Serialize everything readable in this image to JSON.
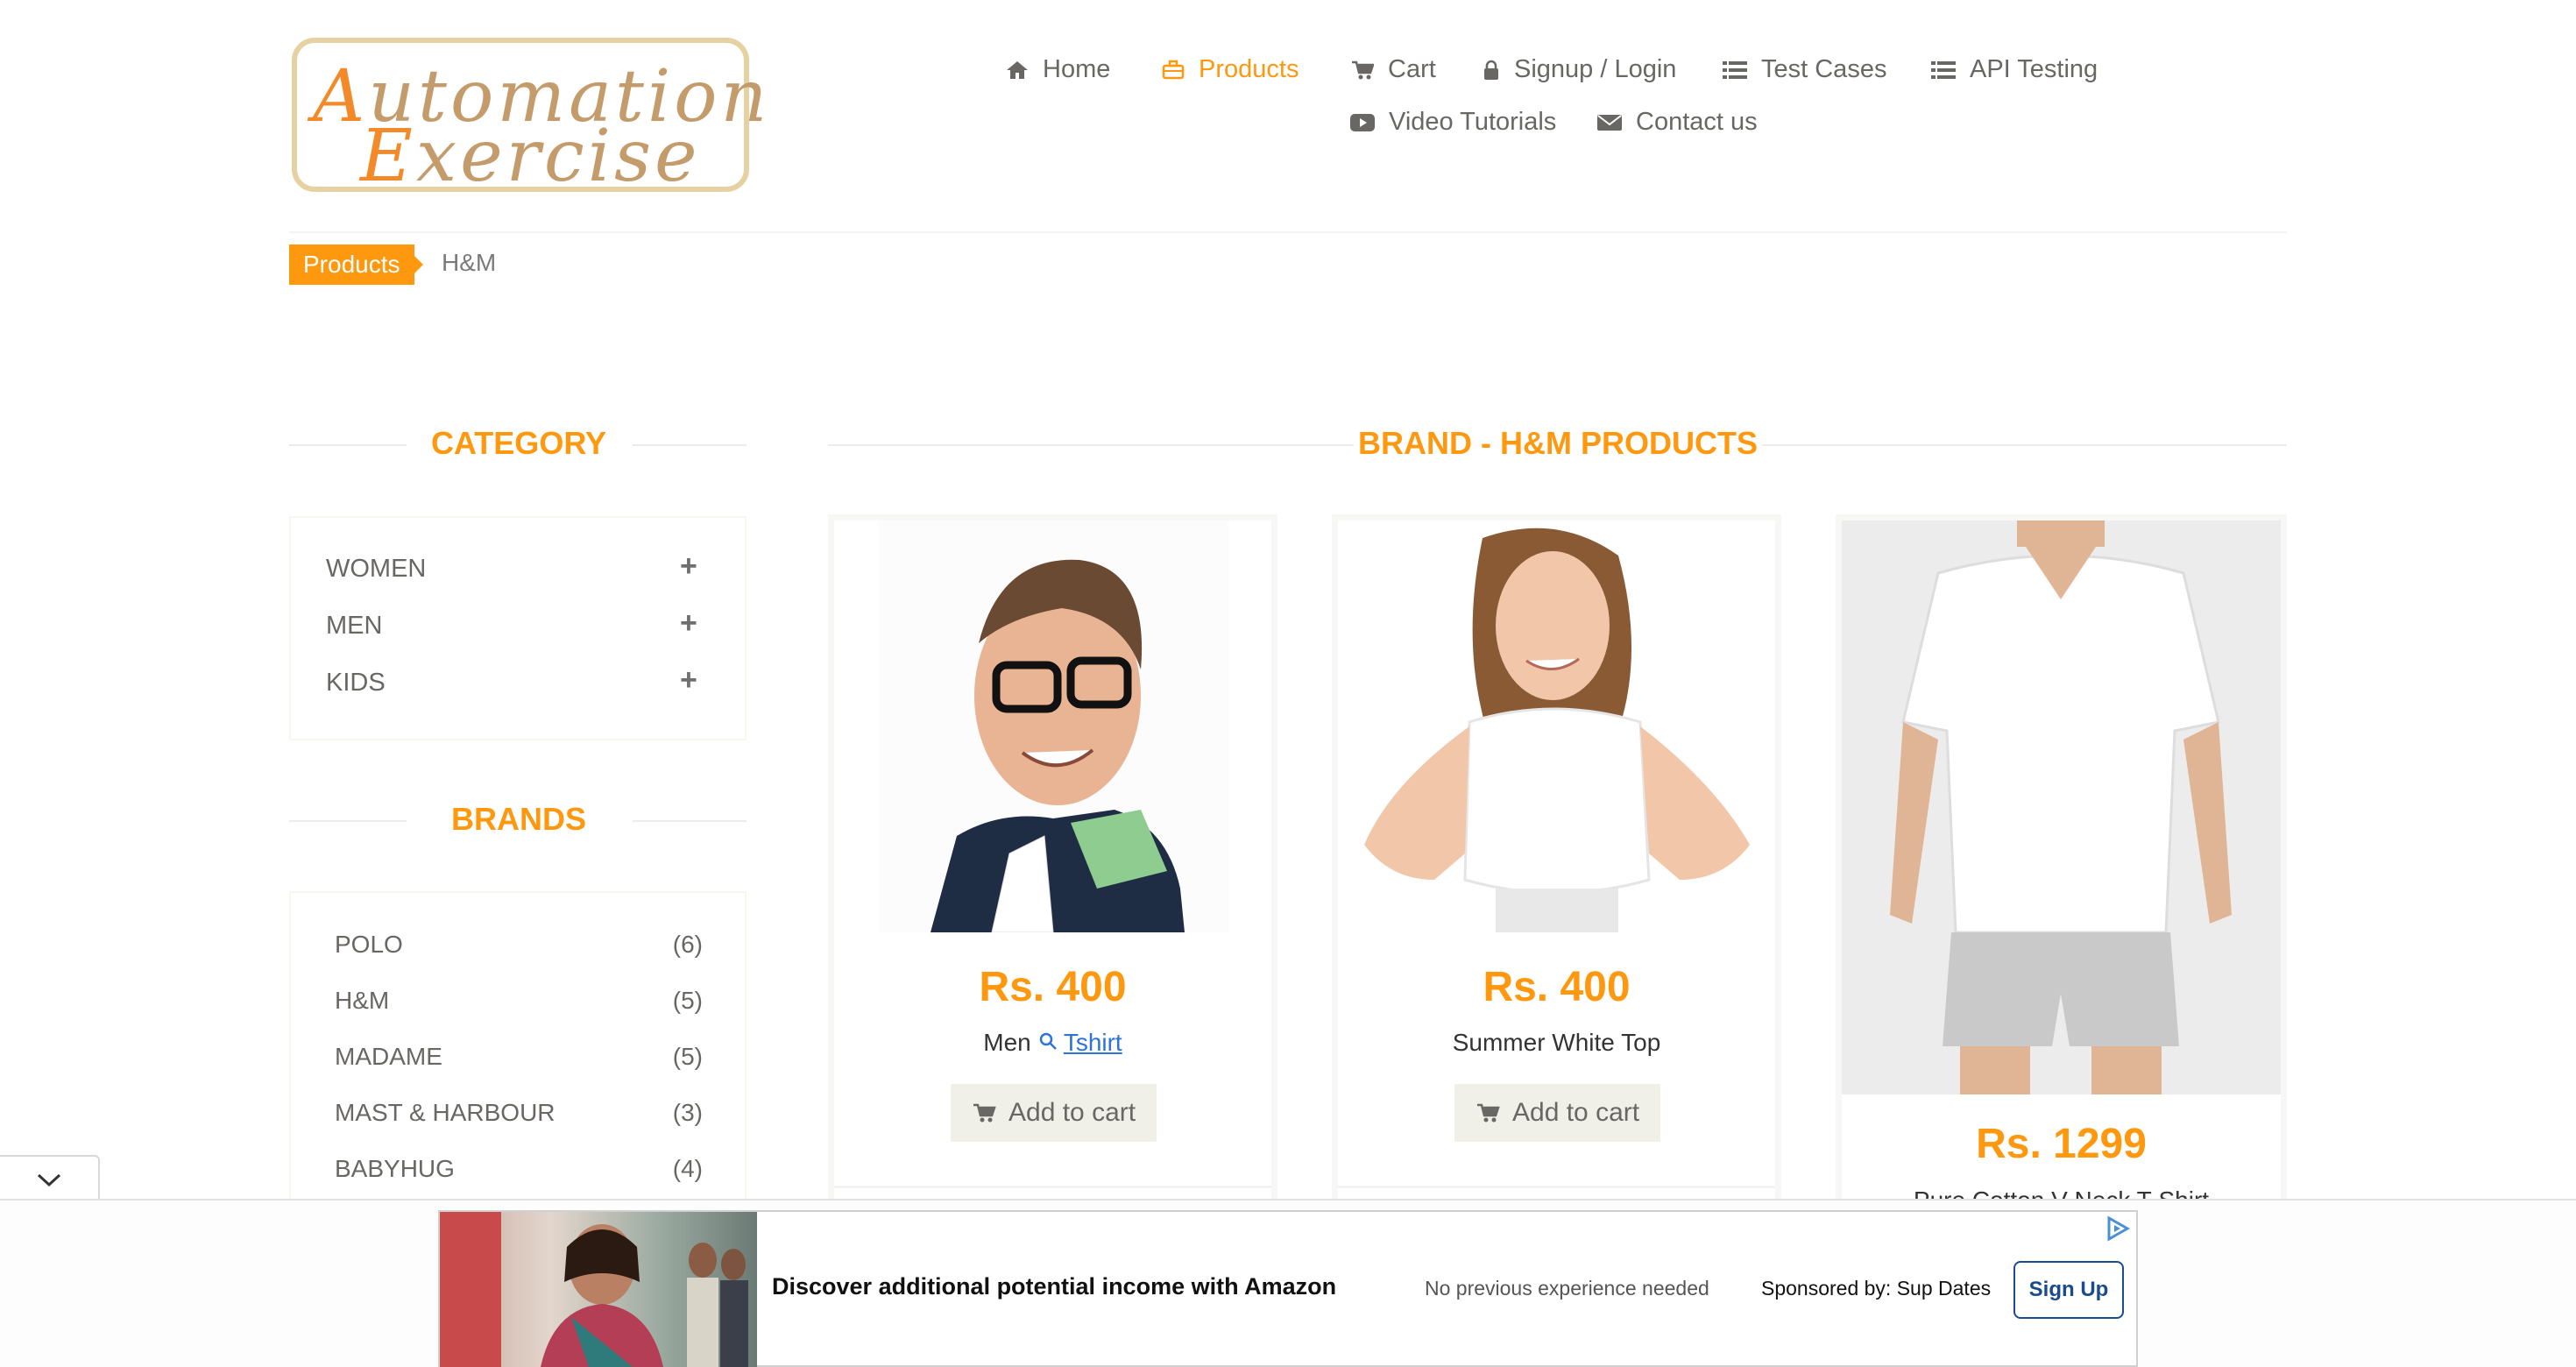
{
  "logo": {
    "line1": "Automation",
    "line2": "Exercise"
  },
  "nav": {
    "home": "Home",
    "products": "Products",
    "cart": "Cart",
    "signup_login": "Signup / Login",
    "test_cases": "Test Cases",
    "api_testing": "API Testing",
    "video_tutorials": "Video Tutorials",
    "contact_us": "Contact us",
    "active": "Products"
  },
  "breadcrumb": {
    "parent": "Products",
    "current": "H&M"
  },
  "sidebar": {
    "category_title": "CATEGORY",
    "categories": [
      {
        "label": "WOMEN"
      },
      {
        "label": "MEN"
      },
      {
        "label": "KIDS"
      }
    ],
    "brands_title": "BRANDS",
    "brands": [
      {
        "name": "POLO",
        "count": "(6)"
      },
      {
        "name": "H&M",
        "count": "(5)"
      },
      {
        "name": "MADAME",
        "count": "(5)"
      },
      {
        "name": "MAST & HARBOUR",
        "count": "(3)"
      },
      {
        "name": "BABYHUG",
        "count": "(4)"
      }
    ]
  },
  "main": {
    "title": "BRAND - H&M PRODUCTS",
    "products": [
      {
        "price": "Rs. 400",
        "name_prefix": "Men",
        "name_link": "Tshirt",
        "button": "Add to cart"
      },
      {
        "price": "Rs. 400",
        "name": "Summer White Top",
        "button": "Add to cart"
      },
      {
        "price": "Rs. 1299",
        "name": "Pure Cotton V-Neck T-Shirt"
      }
    ]
  },
  "ad": {
    "title": "Discover additional potential income with Amazon",
    "subtitle": "No previous experience needed",
    "sponsor": "Sponsored by: Sup Dates",
    "cta": "Sign Up"
  },
  "colors": {
    "accent": "#fe980f",
    "text": "#696763",
    "link": "#2e74d8",
    "ad_button": "#1a4b8c"
  },
  "icons": {
    "home": "home-icon",
    "products": "briefcase-icon",
    "cart": "cart-icon",
    "login": "lock-icon",
    "test_cases": "list-icon",
    "api": "list-icon",
    "video": "play-icon",
    "contact": "envelope-icon",
    "expand": "plus-icon",
    "search": "search-icon",
    "collapse": "chevron-down-icon"
  }
}
